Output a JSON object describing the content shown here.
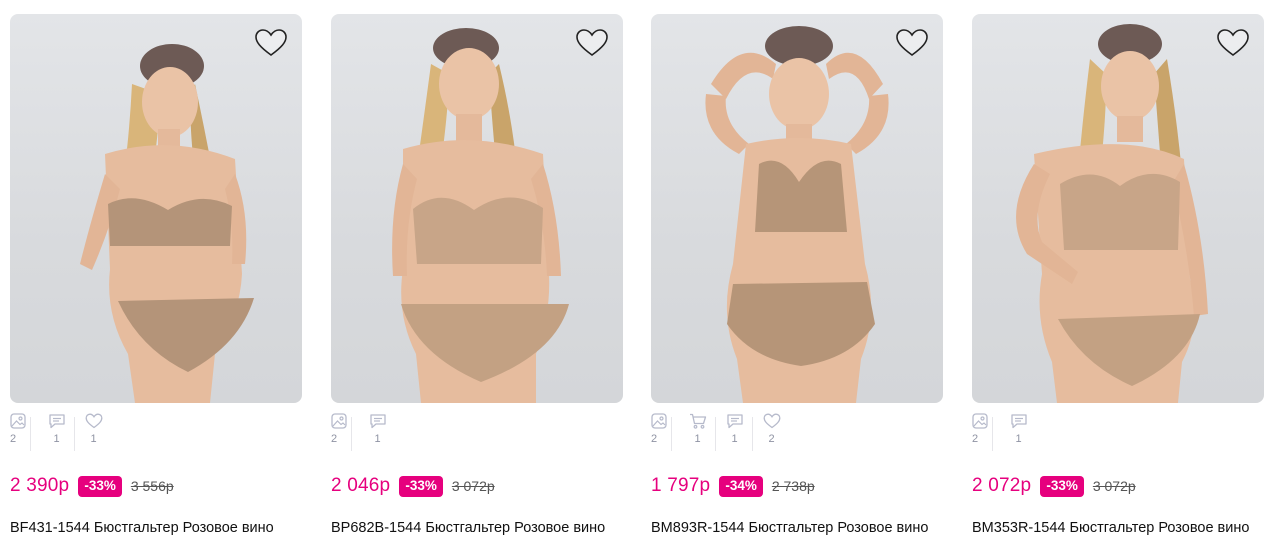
{
  "products": [
    {
      "price": "2 390р",
      "discount": "-33%",
      "old_price": "3 556р",
      "title": "BF431-1544 Бюстгальтер Розовое вино",
      "stats": {
        "photos": "2",
        "reviews": "1",
        "likes": "1"
      }
    },
    {
      "price": "2 046р",
      "discount": "-33%",
      "old_price": "3 072р",
      "title": "BP682B-1544 Бюстгальтер Розовое вино",
      "stats": {
        "photos": "2",
        "reviews": "1"
      }
    },
    {
      "price": "1 797р",
      "discount": "-34%",
      "old_price": "2 738р",
      "title": "BM893R-1544 Бюстгальтер Розовое вино",
      "stats": {
        "photos": "2",
        "cart": "1",
        "reviews": "1",
        "likes": "2"
      }
    },
    {
      "price": "2 072р",
      "discount": "-33%",
      "old_price": "3 072р",
      "title": "BM353R-1544 Бюстгальтер Розовое вино",
      "stats": {
        "photos": "2",
        "reviews": "1"
      }
    }
  ],
  "icons": {
    "favorite": "heart-outline-icon",
    "photos": "image-icon",
    "cart": "cart-icon",
    "reviews": "comment-icon",
    "likes": "heart-icon"
  },
  "colors": {
    "accent": "#e6007e",
    "image_background": "#dcdee1",
    "stat_icon": "#b6bacb"
  }
}
